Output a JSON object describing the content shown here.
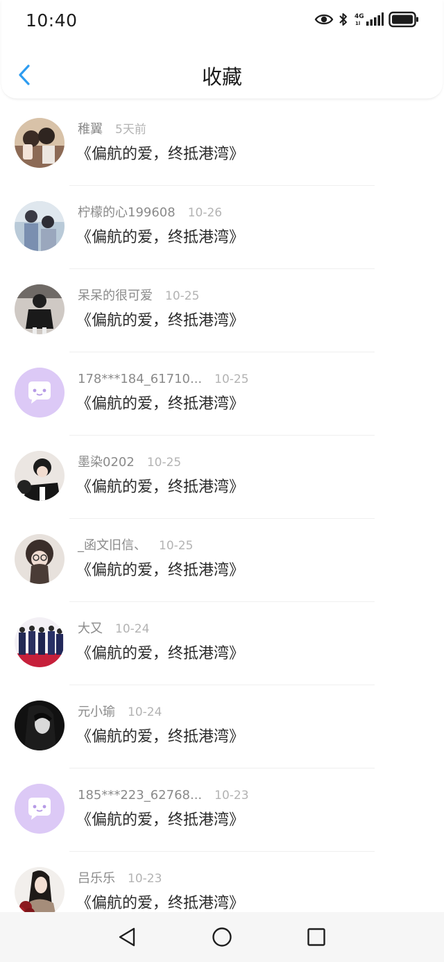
{
  "status_bar": {
    "time": "10:40",
    "network_label_top": "4G",
    "network_label_bottom": "1l",
    "icons": [
      "eye-icon",
      "bluetooth-icon",
      "signal-icon",
      "battery-icon"
    ]
  },
  "header": {
    "title": "收藏",
    "back_icon": "chevron-left-icon"
  },
  "colors": {
    "accent": "#2d9cf0",
    "placeholder_avatar_bg": "#d9c7f5",
    "text_primary": "#2a2a2a",
    "text_secondary": "#8a8a8a",
    "text_tertiary": "#b3b3b3"
  },
  "items": [
    {
      "user": "稚翼",
      "time": "5天前",
      "title": "《偏航的爱，终抵港湾》",
      "avatar": "photo-avatar-1"
    },
    {
      "user": "柠檬的心199608",
      "time": "10-26",
      "title": "《偏航的爱，终抵港湾》",
      "avatar": "photo-avatar-2"
    },
    {
      "user": "呆呆的很可爱",
      "time": "10-25",
      "title": "《偏航的爱，终抵港湾》",
      "avatar": "photo-avatar-3"
    },
    {
      "user": "178***184_61710...",
      "time": "10-25",
      "title": "《偏航的爱，终抵港湾》",
      "avatar": "chat-bubble-placeholder"
    },
    {
      "user": "墨染0202",
      "time": "10-25",
      "title": "《偏航的爱，终抵港湾》",
      "avatar": "photo-avatar-5"
    },
    {
      "user": "_函文旧信、",
      "time": "10-25",
      "title": "《偏航的爱，终抵港湾》",
      "avatar": "photo-avatar-6"
    },
    {
      "user": "大又",
      "time": "10-24",
      "title": "《偏航的爱，终抵港湾》",
      "avatar": "photo-avatar-7"
    },
    {
      "user": "元小瑜",
      "time": "10-24",
      "title": "《偏航的爱，终抵港湾》",
      "avatar": "photo-avatar-8"
    },
    {
      "user": "185***223_62768...",
      "time": "10-23",
      "title": "《偏航的爱，终抵港湾》",
      "avatar": "chat-bubble-placeholder"
    },
    {
      "user": "吕乐乐",
      "time": "10-23",
      "title": "《偏航的爱，终抵港湾》",
      "avatar": "photo-avatar-10"
    }
  ],
  "system_nav": {
    "back": "triangle-back-icon",
    "home": "circle-home-icon",
    "recents": "square-recents-icon"
  }
}
